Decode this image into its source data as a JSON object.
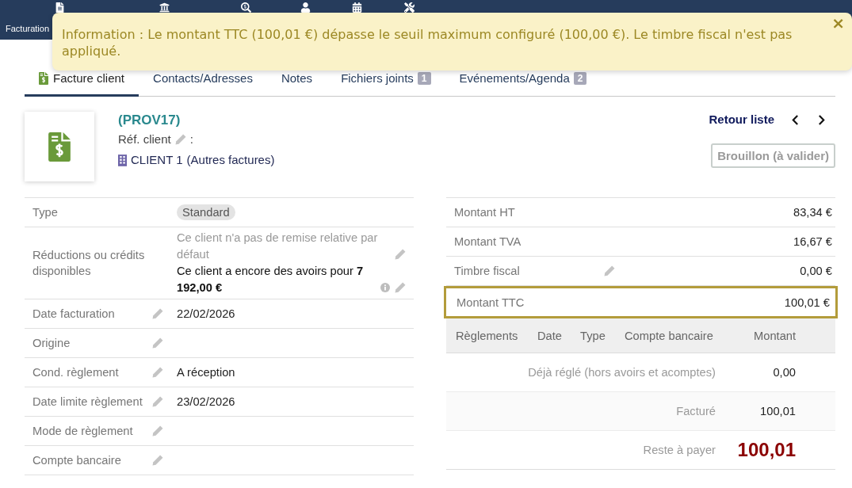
{
  "top_bar": {
    "menu_label": "Facturation"
  },
  "notification": {
    "message": "Information : Le montant TTC (100,01 €) dépasse le seuil maximum configuré (100,00 €). Le timbre fiscal n'est pas appliqué.",
    "close": "×"
  },
  "tabs": [
    {
      "label": "Facture client",
      "selected": true
    },
    {
      "label": "Contacts/Adresses",
      "selected": false
    },
    {
      "label": "Notes",
      "selected": false
    },
    {
      "label": "Fichiers joints",
      "badge": "1",
      "selected": false
    },
    {
      "label": "Evénements/Agenda",
      "badge": "2",
      "selected": false
    }
  ],
  "header": {
    "ref": "(PROV17)",
    "ref_client_label": "Réf. client",
    "ref_client_separator": ":",
    "customer": "CLIENT 1",
    "other_invoices": "(Autres factures)",
    "back_link": "Retour liste",
    "status": "Brouillon (à valider)"
  },
  "fields": [
    {
      "kind": "badge",
      "label": "Type",
      "value": "Standard",
      "editable": false
    },
    {
      "kind": "discounts",
      "label": "Réductions ou crédits disponibles",
      "note": "Ce client n'a pas de remise relative par défaut",
      "credit": "Ce client a encore des avoirs pour **7 192,00 €**",
      "editable": false
    },
    {
      "kind": "text",
      "label": "Date facturation",
      "value": "22/02/2026",
      "editable": true
    },
    {
      "kind": "text",
      "label": "Origine",
      "editable": true
    },
    {
      "kind": "text",
      "label": "Cond. règlement",
      "value": "A réception",
      "editable": true
    },
    {
      "kind": "text",
      "label": "Date limite règlement",
      "value": "23/02/2026",
      "editable": true
    },
    {
      "kind": "text",
      "label": "Mode de règlement",
      "editable": true
    },
    {
      "kind": "text",
      "label": "Compte bancaire",
      "editable": true
    }
  ],
  "totals": [
    {
      "label": "Montant HT",
      "value": "83,34 €",
      "editable": false,
      "highlighted": false
    },
    {
      "label": "Montant TVA",
      "value": "16,67 €",
      "editable": false,
      "highlighted": false
    },
    {
      "label": "Timbre fiscal",
      "value": "0,00 €",
      "editable": true,
      "highlighted": false
    },
    {
      "label": "Montant TTC",
      "value": "100,01 €",
      "editable": false,
      "highlighted": true
    }
  ],
  "payments": {
    "columns": [
      "Règlements",
      "Date",
      "Type",
      "Compte bancaire",
      "Montant"
    ],
    "summary": [
      {
        "kind": "paid",
        "label": "Déjà réglé (hors avoirs et acomptes)",
        "value": "0,00"
      },
      {
        "kind": "billed",
        "label": "Facturé",
        "value": "100,01"
      },
      {
        "kind": "remaining",
        "label": "Reste à payer",
        "value": "100,01"
      }
    ]
  }
}
